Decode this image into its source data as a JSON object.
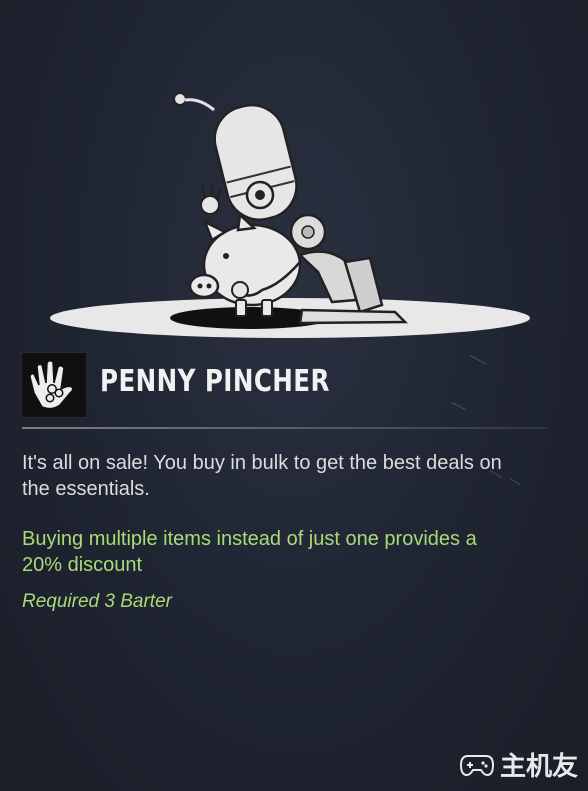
{
  "perk": {
    "name": "PENNY PINCHER",
    "icon": "hand-with-coins-icon",
    "illustration": "vault-boy-robot-with-piggy-bank"
  },
  "description": "It's all on sale! You buy in bulk to get the best deals on the essentials.",
  "effect": "Buying multiple items instead of just one provides a 20% discount",
  "requirement": "Required 3 Barter",
  "watermark": {
    "text": "主机友",
    "icon": "gamepad-icon"
  },
  "colors": {
    "background": "#1f2431",
    "title": "#f1f1f1",
    "body_text": "#dcdcdc",
    "highlight_green": "#a9da77"
  }
}
